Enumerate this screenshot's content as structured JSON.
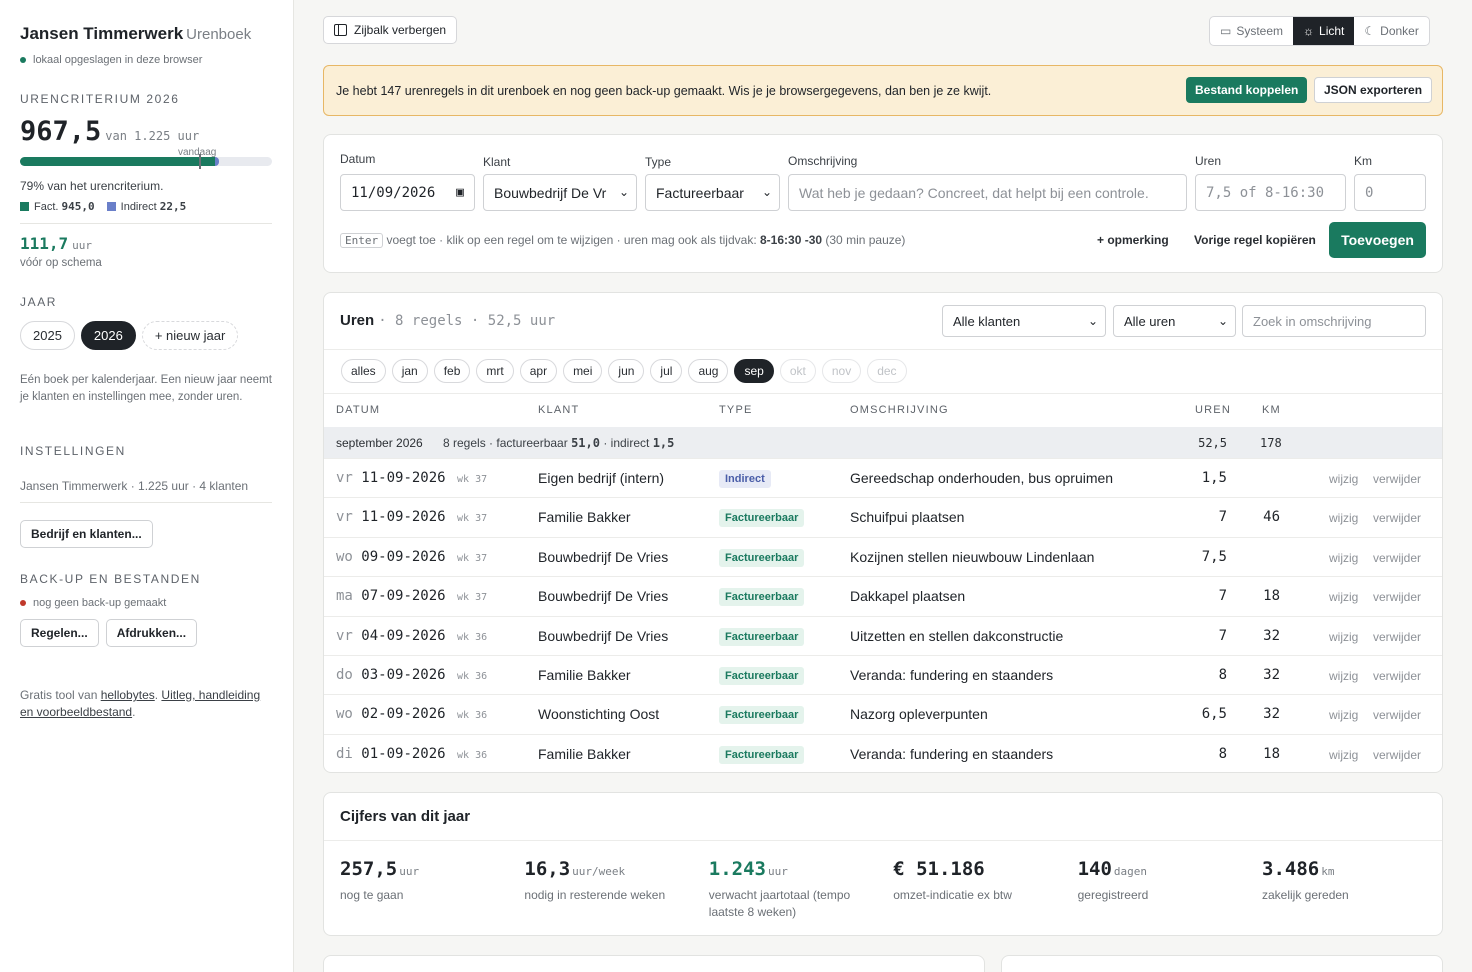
{
  "sidebar": {
    "title": "Jansen Timmerwerk",
    "subtitle": "Urenboek",
    "storage": "lokaal opgeslagen in deze browser",
    "criterion_heading": "URENCRITERIUM 2026",
    "hours_done": "967,5",
    "hours_target": "van 1.225 uur",
    "today_label": "vandaag",
    "progress_fact": 0.772,
    "progress_indirect": 0.018,
    "today_marker": 0.71,
    "progress_text": "79% van het urencriterium.",
    "legend_fact_label": "Fact.",
    "legend_fact_value": "945,0",
    "legend_ind_label": "Indirect",
    "legend_ind_value": "22,5",
    "ahead_value": "111,7",
    "ahead_unit": "uur",
    "ahead_text": "vóór op schema",
    "year_heading": "JAAR",
    "years": [
      "2025",
      "2026"
    ],
    "new_year": "+ nieuw jaar",
    "year_note": "Eén boek per kalenderjaar. Een nieuw jaar neemt je klanten en instellingen mee, zonder uren.",
    "settings_heading": "INSTELLINGEN",
    "settings_summary": "Jansen Timmerwerk · 1.225 uur · 4 klanten",
    "settings_button": "Bedrijf en klanten...",
    "backup_heading": "BACK-UP EN BESTANDEN",
    "backup_status": "nog geen back-up gemaakt",
    "btn_rules": "Regelen...",
    "btn_print": "Afdrukken...",
    "footer_prefix": "Gratis tool van ",
    "footer_link1": "hellobytes",
    "footer_mid": ". ",
    "footer_link2a": "Uitleg, handleiding",
    "footer_link2b": "en voorbeeldbestand",
    "footer_end": "."
  },
  "topbar": {
    "toggle_sidebar": "Zijbalk verbergen",
    "theme_system": "Systeem",
    "theme_light": "Licht",
    "theme_dark": "Donker"
  },
  "banner": {
    "text": "Je hebt 147 urenregels in dit urenboek en nog geen back-up gemaakt. Wis je je browsergegevens, dan ben je ze kwijt.",
    "btn_link": "Bestand koppelen",
    "btn_export": "JSON exporteren"
  },
  "form": {
    "date_label": "Datum",
    "date_value": "11/09/2026",
    "client_label": "Klant",
    "client_value": "Bouwbedrijf De Vr",
    "type_label": "Type",
    "type_value": "Factureerbaar",
    "desc_label": "Omschrijving",
    "desc_placeholder": "Wat heb je gedaan? Concreet, dat helpt bij een controle.",
    "hours_label": "Uren",
    "hours_placeholder": "7,5 of 8-16:30",
    "km_label": "Km",
    "km_placeholder": "0",
    "hint_key": "Enter",
    "hint_text": "voegt toe · klik op een regel om te wijzigen · uren mag ook als tijdvak:",
    "hint_example": "8-16:30 -30",
    "hint_tail": "(30 min pauze)",
    "add_note": "+ opmerking",
    "copy_prev": "Vorige regel kopiëren",
    "submit": "Toevoegen"
  },
  "hours": {
    "title": "Uren",
    "summary": "· 8 regels · 52,5 uur",
    "filter_client": "Alle klanten",
    "filter_hours": "Alle uren",
    "search_placeholder": "Zoek in omschrijving",
    "months": [
      {
        "label": "alles",
        "state": "normal"
      },
      {
        "label": "jan",
        "state": "normal"
      },
      {
        "label": "feb",
        "state": "normal"
      },
      {
        "label": "mrt",
        "state": "normal"
      },
      {
        "label": "apr",
        "state": "normal"
      },
      {
        "label": "mei",
        "state": "normal"
      },
      {
        "label": "jun",
        "state": "normal"
      },
      {
        "label": "jul",
        "state": "normal"
      },
      {
        "label": "aug",
        "state": "normal"
      },
      {
        "label": "sep",
        "state": "on"
      },
      {
        "label": "okt",
        "state": "off"
      },
      {
        "label": "nov",
        "state": "off"
      },
      {
        "label": "dec",
        "state": "off"
      }
    ],
    "headers": {
      "date": "DATUM",
      "client": "KLANT",
      "type": "TYPE",
      "desc": "OMSCHRIJVING",
      "hours": "UREN",
      "km": "KM"
    },
    "group_label": "september 2026",
    "group_detail_a": "8 regels · factureerbaar",
    "group_fact": "51,0",
    "group_detail_b": "· indirect",
    "group_ind": "1,5",
    "group_hours": "52,5",
    "group_km": "178",
    "edit": "wijzig",
    "delete": "verwijder",
    "rows": [
      {
        "day": "vr",
        "date": "11-09-2026",
        "wk": "wk 37",
        "client": "Eigen bedrijf (intern)",
        "type": "Indirect",
        "desc": "Gereedschap onderhouden, bus opruimen",
        "hours": "1,5",
        "km": ""
      },
      {
        "day": "vr",
        "date": "11-09-2026",
        "wk": "wk 37",
        "client": "Familie Bakker",
        "type": "Factureerbaar",
        "desc": "Schuifpui plaatsen",
        "hours": "7",
        "km": "46"
      },
      {
        "day": "wo",
        "date": "09-09-2026",
        "wk": "wk 37",
        "client": "Bouwbedrijf De Vries",
        "type": "Factureerbaar",
        "desc": "Kozijnen stellen nieuwbouw Lindenlaan",
        "hours": "7,5",
        "km": ""
      },
      {
        "day": "ma",
        "date": "07-09-2026",
        "wk": "wk 37",
        "client": "Bouwbedrijf De Vries",
        "type": "Factureerbaar",
        "desc": "Dakkapel plaatsen",
        "hours": "7",
        "km": "18"
      },
      {
        "day": "vr",
        "date": "04-09-2026",
        "wk": "wk 36",
        "client": "Bouwbedrijf De Vries",
        "type": "Factureerbaar",
        "desc": "Uitzetten en stellen dakconstructie",
        "hours": "7",
        "km": "32"
      },
      {
        "day": "do",
        "date": "03-09-2026",
        "wk": "wk 36",
        "client": "Familie Bakker",
        "type": "Factureerbaar",
        "desc": "Veranda: fundering en staanders",
        "hours": "8",
        "km": "32"
      },
      {
        "day": "wo",
        "date": "02-09-2026",
        "wk": "wk 36",
        "client": "Woonstichting Oost",
        "type": "Factureerbaar",
        "desc": "Nazorg opleverpunten",
        "hours": "6,5",
        "km": "32"
      },
      {
        "day": "di",
        "date": "01-09-2026",
        "wk": "wk 36",
        "client": "Familie Bakker",
        "type": "Factureerbaar",
        "desc": "Veranda: fundering en staanders",
        "hours": "8",
        "km": "18"
      }
    ]
  },
  "stats": {
    "title": "Cijfers van dit jaar",
    "items": [
      {
        "value": "257,5",
        "unit": "uur",
        "label": "nog te gaan",
        "color": "#1f2328"
      },
      {
        "value": "16,3",
        "unit": "uur/week",
        "label": "nodig in resterende weken",
        "color": "#1f2328"
      },
      {
        "value": "1.243",
        "unit": "uur",
        "label": "verwacht jaartotaal (tempo laatste 8 weken)",
        "color": "#1a7a5f"
      },
      {
        "value": "€ 51.186",
        "unit": "",
        "label": "omzet-indicatie ex btw",
        "color": "#1f2328"
      },
      {
        "value": "140",
        "unit": "dagen",
        "label": "geregistreerd",
        "color": "#1f2328"
      },
      {
        "value": "3.486",
        "unit": "km",
        "label": "zakelijk gereden",
        "color": "#1f2328"
      }
    ]
  },
  "colors": {
    "accent": "#1a7a5f",
    "indirect": "#6a7fc9",
    "warning_bg": "#fbefd6",
    "warning_dot": "#c0392b"
  }
}
